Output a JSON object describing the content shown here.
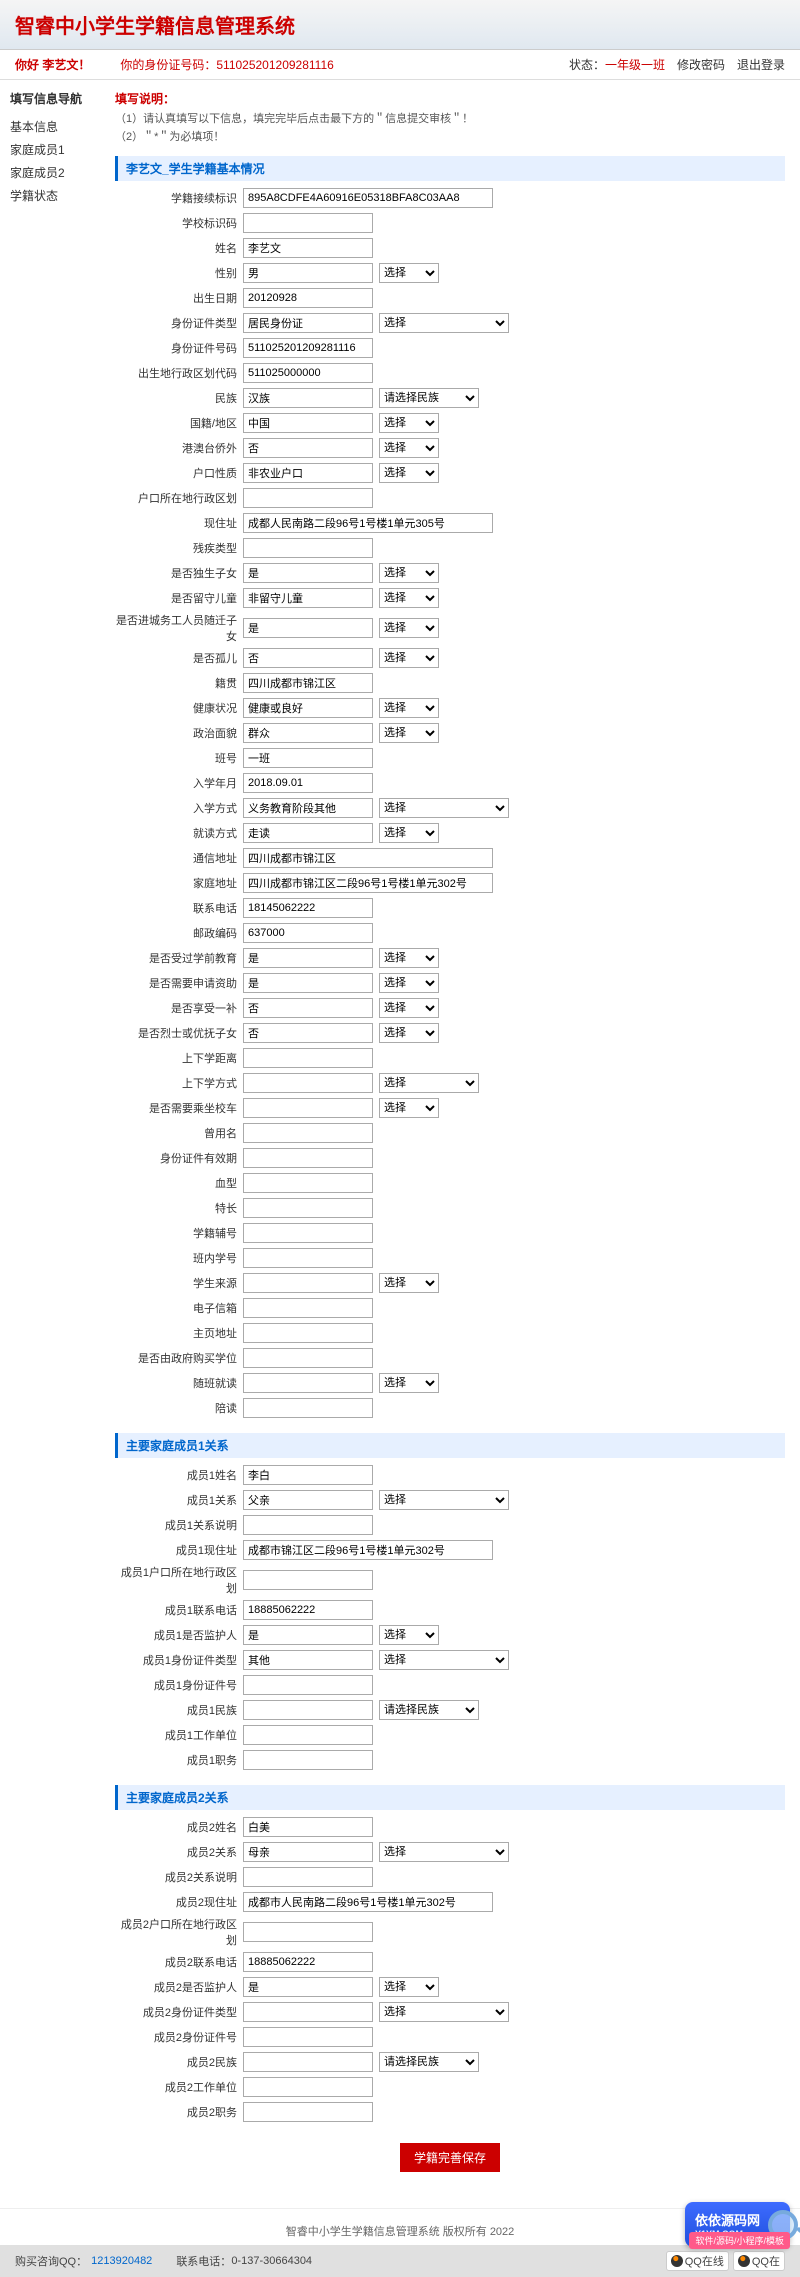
{
  "header": {
    "title": "智睿中小学生学籍信息管理系统"
  },
  "userbar": {
    "greeting": "你好 李艺文！",
    "id_label": "你的身份证号码：",
    "id_value": "511025201209281116",
    "status_label": "状态：",
    "status_value": "一年级一班",
    "change_pwd": "修改密码",
    "logout": "退出登录"
  },
  "sidebar": {
    "title": "填写信息导航",
    "items": [
      "基本信息",
      "家庭成员1",
      "家庭成员2",
      "学籍状态"
    ]
  },
  "instructions": {
    "title": "填写说明：",
    "line1": "（1）请认真填写以下信息，填完完毕后点击最下方的＂信息提交审核＂！",
    "line2": "（2）＂*＂为必填项！"
  },
  "sections": {
    "basic": {
      "title": "李艺文_学生学籍基本情况",
      "fields": [
        {
          "label": "学籍接续标识",
          "value": "895A8CDFE4A60916E05318BFA8C03AA8",
          "name": "reg-id",
          "wide": true
        },
        {
          "label": "学校标识码",
          "value": "",
          "name": "school-code"
        },
        {
          "label": "姓名",
          "value": "李艺文",
          "name": "name"
        },
        {
          "label": "性别",
          "value": "男",
          "name": "gender",
          "sel": "选择",
          "selsize": "sm"
        },
        {
          "label": "出生日期",
          "value": "20120928",
          "name": "birthdate"
        },
        {
          "label": "身份证件类型",
          "value": "居民身份证",
          "name": "id-type",
          "sel": "选择",
          "selsize": "lg"
        },
        {
          "label": "身份证件号码",
          "value": "511025201209281116",
          "name": "id-number"
        },
        {
          "label": "出生地行政区划代码",
          "value": "511025000000",
          "name": "birth-region-code"
        },
        {
          "label": "民族",
          "value": "汉族",
          "name": "ethnicity",
          "sel": "请选择民族",
          "selsize": "md"
        },
        {
          "label": "国籍/地区",
          "value": "中国",
          "name": "nationality",
          "sel": "选择",
          "selsize": "sm"
        },
        {
          "label": "港澳台侨外",
          "value": "否",
          "name": "hk-mo-tw",
          "sel": "选择",
          "selsize": "sm"
        },
        {
          "label": "户口性质",
          "value": "非农业户口",
          "name": "hukou-type",
          "sel": "选择",
          "selsize": "sm"
        },
        {
          "label": "户口所在地行政区划",
          "value": "",
          "name": "hukou-region"
        },
        {
          "label": "现住址",
          "value": "成都人民南路二段96号1号楼1单元305号",
          "name": "address",
          "wide": true
        },
        {
          "label": "残疾类型",
          "value": "",
          "name": "disability-type"
        },
        {
          "label": "是否独生子女",
          "value": "是",
          "name": "only-child",
          "sel": "选择",
          "selsize": "sm"
        },
        {
          "label": "是否留守儿童",
          "value": "非留守儿童",
          "name": "left-behind",
          "sel": "选择",
          "selsize": "sm"
        },
        {
          "label": "是否进城务工人员随迁子女",
          "value": "是",
          "name": "migrant-child",
          "sel": "选择",
          "selsize": "sm"
        },
        {
          "label": "是否孤儿",
          "value": "否",
          "name": "orphan",
          "sel": "选择",
          "selsize": "sm"
        },
        {
          "label": "籍贯",
          "value": "四川成都市锦江区",
          "name": "native-place"
        },
        {
          "label": "健康状况",
          "value": "健康或良好",
          "name": "health",
          "sel": "选择",
          "selsize": "sm"
        },
        {
          "label": "政治面貌",
          "value": "群众",
          "name": "politics",
          "sel": "选择",
          "selsize": "sm"
        },
        {
          "label": "班号",
          "value": "一班",
          "name": "class-no"
        },
        {
          "label": "入学年月",
          "value": "2018.09.01",
          "name": "enroll-date"
        },
        {
          "label": "入学方式",
          "value": "义务教育阶段其他",
          "name": "enroll-method",
          "sel": "选择",
          "selsize": "lg"
        },
        {
          "label": "就读方式",
          "value": "走读",
          "name": "study-mode",
          "sel": "选择",
          "selsize": "sm"
        },
        {
          "label": "通信地址",
          "value": "四川成都市锦江区",
          "name": "mail-address",
          "wide": true
        },
        {
          "label": "家庭地址",
          "value": "四川成都市锦江区二段96号1号楼1单元302号",
          "name": "home-address",
          "wide": true
        },
        {
          "label": "联系电话",
          "value": "18145062222",
          "name": "phone"
        },
        {
          "label": "邮政编码",
          "value": "637000",
          "name": "postcode"
        },
        {
          "label": "是否受过学前教育",
          "value": "是",
          "name": "preschool",
          "sel": "选择",
          "selsize": "sm"
        },
        {
          "label": "是否需要申请资助",
          "value": "是",
          "name": "need-aid",
          "sel": "选择",
          "selsize": "sm"
        },
        {
          "label": "是否享受一补",
          "value": "否",
          "name": "subsidy",
          "sel": "选择",
          "selsize": "sm"
        },
        {
          "label": "是否烈士或优抚子女",
          "value": "否",
          "name": "martyr-child",
          "sel": "选择",
          "selsize": "sm"
        },
        {
          "label": "上下学距离",
          "value": "",
          "name": "commute-distance"
        },
        {
          "label": "上下学方式",
          "value": "",
          "name": "commute-mode",
          "sel": "选择",
          "selsize": "md"
        },
        {
          "label": "是否需要乘坐校车",
          "value": "",
          "name": "school-bus",
          "sel": "选择",
          "selsize": "sm"
        },
        {
          "label": "曾用名",
          "value": "",
          "name": "former-name"
        },
        {
          "label": "身份证件有效期",
          "value": "",
          "name": "id-validity"
        },
        {
          "label": "血型",
          "value": "",
          "name": "blood-type"
        },
        {
          "label": "特长",
          "value": "",
          "name": "specialty"
        },
        {
          "label": "学籍辅号",
          "value": "",
          "name": "reg-aux-no"
        },
        {
          "label": "班内学号",
          "value": "",
          "name": "class-student-no"
        },
        {
          "label": "学生来源",
          "value": "",
          "name": "student-source",
          "sel": "选择",
          "selsize": "sm"
        },
        {
          "label": "电子信箱",
          "value": "",
          "name": "email"
        },
        {
          "label": "主页地址",
          "value": "",
          "name": "homepage"
        },
        {
          "label": "是否由政府购买学位",
          "value": "",
          "name": "gov-purchase"
        },
        {
          "label": "随班就读",
          "value": "",
          "name": "inclusive-edu",
          "sel": "选择",
          "selsize": "sm"
        },
        {
          "label": "陪读",
          "value": "",
          "name": "accompany"
        }
      ]
    },
    "member1": {
      "title": "主要家庭成员1关系",
      "fields": [
        {
          "label": "成员1姓名",
          "value": "李白",
          "name": "m1-name"
        },
        {
          "label": "成员1关系",
          "value": "父亲",
          "name": "m1-relation",
          "sel": "选择",
          "selsize": "lg"
        },
        {
          "label": "成员1关系说明",
          "value": "",
          "name": "m1-relation-desc"
        },
        {
          "label": "成员1现住址",
          "value": "成都市锦江区二段96号1号楼1单元302号",
          "name": "m1-address",
          "wide": true
        },
        {
          "label": "成员1户口所在地行政区划",
          "value": "",
          "name": "m1-hukou"
        },
        {
          "label": "成员1联系电话",
          "value": "18885062222",
          "name": "m1-phone"
        },
        {
          "label": "成员1是否监护人",
          "value": "是",
          "name": "m1-guardian",
          "sel": "选择",
          "selsize": "sm"
        },
        {
          "label": "成员1身份证件类型",
          "value": "其他",
          "name": "m1-id-type",
          "sel": "选择",
          "selsize": "lg"
        },
        {
          "label": "成员1身份证件号",
          "value": "",
          "name": "m1-id-no"
        },
        {
          "label": "成员1民族",
          "value": "",
          "name": "m1-ethnicity",
          "sel": "请选择民族",
          "selsize": "md"
        },
        {
          "label": "成员1工作单位",
          "value": "",
          "name": "m1-employer"
        },
        {
          "label": "成员1职务",
          "value": "",
          "name": "m1-position"
        }
      ]
    },
    "member2": {
      "title": "主要家庭成员2关系",
      "fields": [
        {
          "label": "成员2姓名",
          "value": "白美",
          "name": "m2-name"
        },
        {
          "label": "成员2关系",
          "value": "母亲",
          "name": "m2-relation",
          "sel": "选择",
          "selsize": "lg"
        },
        {
          "label": "成员2关系说明",
          "value": "",
          "name": "m2-relation-desc"
        },
        {
          "label": "成员2现住址",
          "value": "成都市人民南路二段96号1号楼1单元302号",
          "name": "m2-address",
          "wide": true
        },
        {
          "label": "成员2户口所在地行政区划",
          "value": "",
          "name": "m2-hukou"
        },
        {
          "label": "成员2联系电话",
          "value": "18885062222",
          "name": "m2-phone"
        },
        {
          "label": "成员2是否监护人",
          "value": "是",
          "name": "m2-guardian",
          "sel": "选择",
          "selsize": "sm"
        },
        {
          "label": "成员2身份证件类型",
          "value": "",
          "name": "m2-id-type",
          "sel": "选择",
          "selsize": "lg"
        },
        {
          "label": "成员2身份证件号",
          "value": "",
          "name": "m2-id-no"
        },
        {
          "label": "成员2民族",
          "value": "",
          "name": "m2-ethnicity",
          "sel": "请选择民族",
          "selsize": "md"
        },
        {
          "label": "成员2工作单位",
          "value": "",
          "name": "m2-employer"
        },
        {
          "label": "成员2职务",
          "value": "",
          "name": "m2-position"
        }
      ]
    }
  },
  "submit": "学籍完善保存",
  "footer": "智睿中小学生学籍信息管理系统 版权所有 2022",
  "bottombar": {
    "consult_label": "购买咨询QQ：",
    "consult_value": "1213920482",
    "phone_label": "联系电话：",
    "phone_value": "0-137-30664304",
    "qq_online": "QQ在线",
    "qq_online2": "QQ在"
  },
  "watermark": {
    "brand": "依依源码网",
    "url": "Y1YM.COM",
    "tag": "软件/源码/小程序/模板"
  }
}
